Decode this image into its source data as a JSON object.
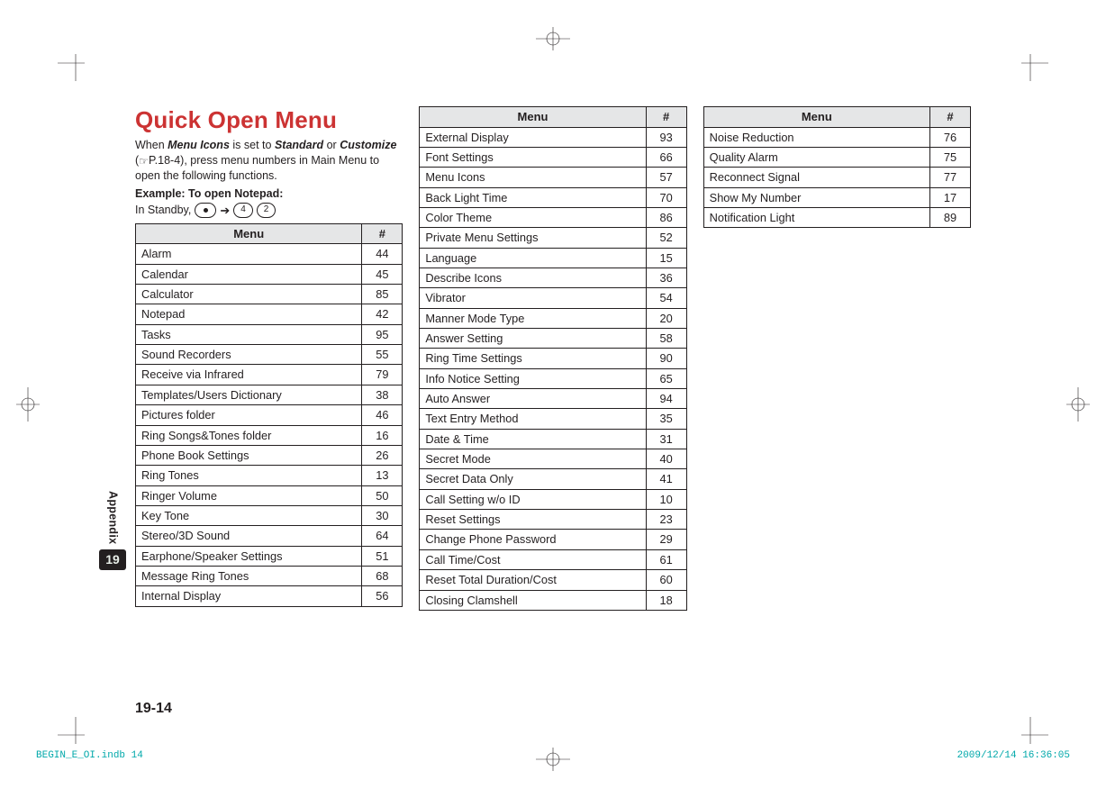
{
  "title": "Quick Open Menu",
  "intro_parts": {
    "a": "When ",
    "menu_icons": "Menu Icons",
    "b": " is set to ",
    "standard": "Standard",
    "c": " or ",
    "customize": "Customize",
    "d": " (",
    "ref": "P.18-4",
    "e": "), press menu numbers in Main Menu to open the following functions."
  },
  "example_label": "Example: To open Notepad:",
  "standby_prefix": "In Standby,",
  "key_sequence": [
    "4",
    "2"
  ],
  "th_menu": "Menu",
  "th_num": "#",
  "tables": [
    [
      {
        "m": "Alarm",
        "n": "44"
      },
      {
        "m": "Calendar",
        "n": "45"
      },
      {
        "m": "Calculator",
        "n": "85"
      },
      {
        "m": "Notepad",
        "n": "42"
      },
      {
        "m": "Tasks",
        "n": "95"
      },
      {
        "m": "Sound Recorders",
        "n": "55"
      },
      {
        "m": "Receive via Infrared",
        "n": "79"
      },
      {
        "m": "Templates/Users Dictionary",
        "n": "38"
      },
      {
        "m": "Pictures folder",
        "n": "46"
      },
      {
        "m": "Ring Songs&Tones folder",
        "n": "16"
      },
      {
        "m": "Phone Book Settings",
        "n": "26"
      },
      {
        "m": "Ring Tones",
        "n": "13"
      },
      {
        "m": "Ringer Volume",
        "n": "50"
      },
      {
        "m": "Key Tone",
        "n": "30"
      },
      {
        "m": "Stereo/3D Sound",
        "n": "64"
      },
      {
        "m": "Earphone/Speaker Settings",
        "n": "51"
      },
      {
        "m": "Message Ring Tones",
        "n": "68"
      },
      {
        "m": "Internal Display",
        "n": "56"
      }
    ],
    [
      {
        "m": "External Display",
        "n": "93"
      },
      {
        "m": "Font Settings",
        "n": "66"
      },
      {
        "m": "Menu Icons",
        "n": "57"
      },
      {
        "m": "Back Light Time",
        "n": "70"
      },
      {
        "m": "Color Theme",
        "n": "86"
      },
      {
        "m": "Private Menu Settings",
        "n": "52"
      },
      {
        "m": "Language",
        "n": "15"
      },
      {
        "m": "Describe Icons",
        "n": "36"
      },
      {
        "m": "Vibrator",
        "n": "54"
      },
      {
        "m": "Manner Mode Type",
        "n": "20"
      },
      {
        "m": "Answer Setting",
        "n": "58"
      },
      {
        "m": "Ring Time Settings",
        "n": "90"
      },
      {
        "m": "Info Notice Setting",
        "n": "65"
      },
      {
        "m": "Auto Answer",
        "n": "94"
      },
      {
        "m": "Text Entry Method",
        "n": "35"
      },
      {
        "m": "Date & Time",
        "n": "31"
      },
      {
        "m": "Secret Mode",
        "n": "40"
      },
      {
        "m": "Secret Data Only",
        "n": "41"
      },
      {
        "m": "Call Setting w/o ID",
        "n": "10"
      },
      {
        "m": "Reset Settings",
        "n": "23"
      },
      {
        "m": "Change Phone Password",
        "n": "29"
      },
      {
        "m": "Call Time/Cost",
        "n": "61"
      },
      {
        "m": "Reset Total Duration/Cost",
        "n": "60"
      },
      {
        "m": "Closing Clamshell",
        "n": "18"
      }
    ],
    [
      {
        "m": "Noise Reduction",
        "n": "76"
      },
      {
        "m": "Quality Alarm",
        "n": "75"
      },
      {
        "m": "Reconnect Signal",
        "n": "77"
      },
      {
        "m": "Show My Number",
        "n": "17"
      },
      {
        "m": "Notification Light",
        "n": "89"
      }
    ]
  ],
  "sidetab": {
    "label": "Appendix",
    "chapter": "19"
  },
  "page_number": "19-14",
  "imprint": {
    "file": "BEGIN_E_OI.indb   14",
    "timestamp": "2009/12/14   16:36:05"
  }
}
